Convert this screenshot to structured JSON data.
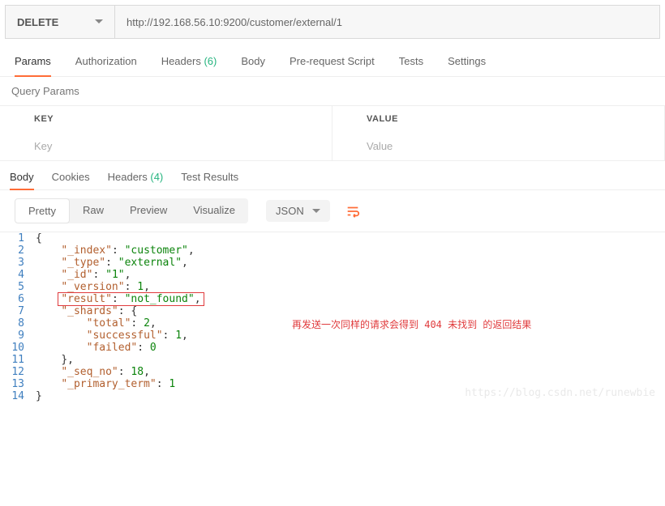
{
  "request": {
    "method": "DELETE",
    "url": "http://192.168.56.10:9200/customer/external/1"
  },
  "reqTabs": {
    "params": "Params",
    "auth": "Authorization",
    "headers": "Headers",
    "headersCount": "(6)",
    "body": "Body",
    "prescript": "Pre-request Script",
    "tests": "Tests",
    "settings": "Settings"
  },
  "queryParams": {
    "title": "Query Params",
    "keyHeader": "KEY",
    "valueHeader": "VALUE",
    "keyPh": "Key",
    "valuePh": "Value"
  },
  "respTabs": {
    "body": "Body",
    "cookies": "Cookies",
    "headers": "Headers",
    "headersCount": "(4)",
    "tests": "Test Results"
  },
  "view": {
    "pretty": "Pretty",
    "raw": "Raw",
    "preview": "Preview",
    "visualize": "Visualize",
    "json": "JSON"
  },
  "annotation": "再发送一次同样的请求会得到 404 未找到 的返回结果",
  "watermark": "https://blog.csdn.net/runewbie",
  "json": {
    "_index": "customer",
    "_type": "external",
    "_id": "1",
    "_version": 1,
    "result": "not_found",
    "_shards": {
      "total": 2,
      "successful": 1,
      "failed": 0
    },
    "_seq_no": 18,
    "_primary_term": 1
  }
}
